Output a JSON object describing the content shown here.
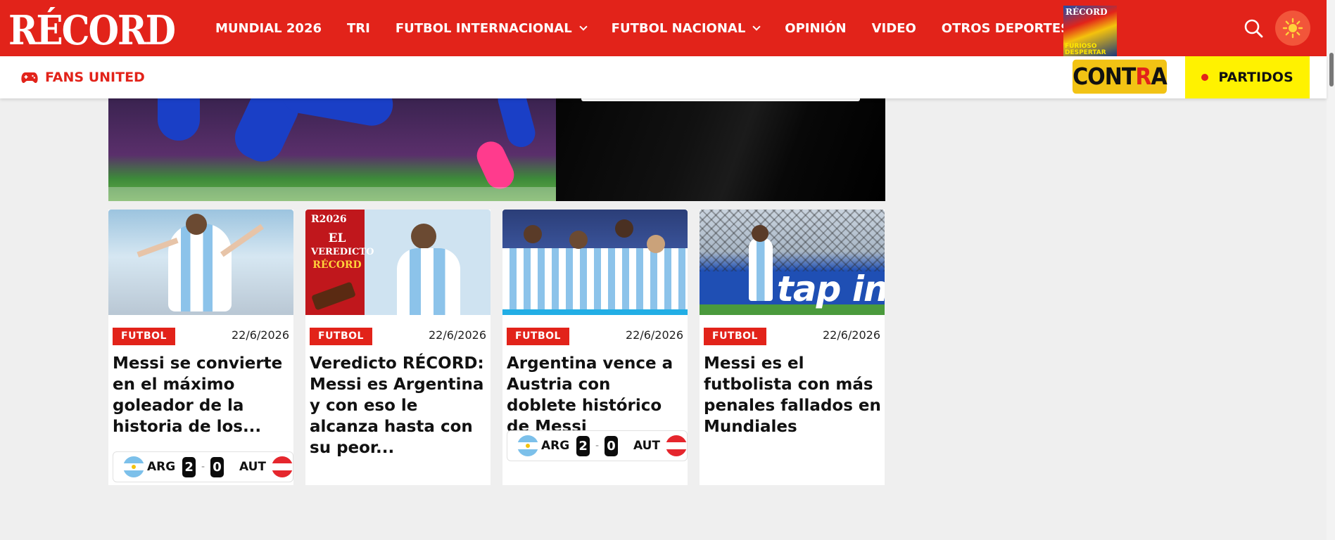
{
  "header": {
    "logo_text": "RÉCORD",
    "nav": [
      {
        "label": "MUNDIAL 2026",
        "has_dropdown": false
      },
      {
        "label": "TRI",
        "has_dropdown": false
      },
      {
        "label": "FUTBOL INTERNACIONAL",
        "has_dropdown": true
      },
      {
        "label": "FUTBOL NACIONAL",
        "has_dropdown": true
      },
      {
        "label": "OPINIÓN",
        "has_dropdown": false
      },
      {
        "label": "VIDEO",
        "has_dropdown": false
      },
      {
        "label": "OTROS DEPORTES",
        "has_dropdown": true
      }
    ],
    "cover": {
      "title": "RÉCORD",
      "headline": "FURIOSO DESPERTAR"
    },
    "icons": {
      "search": "search-icon",
      "theme": "sun-icon"
    },
    "colors": {
      "brand": "#e2231a",
      "theme_button": "#f2553a"
    }
  },
  "subbar": {
    "fans_label": "FANS UNITED",
    "contra_pre": "CONT",
    "contra_r": "R",
    "contra_post": "A",
    "partidos_label": "PARTIDOS",
    "partidos_color": "#fff200"
  },
  "cards": [
    {
      "tag": "FUTBOL",
      "date": "22/6/2026",
      "headline": "Messi se convierte en el máximo goleador de la historia de los...",
      "score": {
        "home": "ARG",
        "home_goals": "2",
        "away_goals": "0",
        "away": "AUT"
      }
    },
    {
      "tag": "FUTBOL",
      "date": "22/6/2026",
      "headline": "Veredicto RÉCORD: Messi es Argentina y con eso le alcanza hasta con su peor...",
      "thumb_text": {
        "year": "R2026",
        "line1": "EL",
        "line2": "VEREDICTO",
        "line3": "RÉCORD"
      }
    },
    {
      "tag": "FUTBOL",
      "date": "22/6/2026",
      "headline": "Argentina vence a Austria con doblete histórico de Messi",
      "score": {
        "home": "ARG",
        "home_goals": "2",
        "away_goals": "0",
        "away": "AUT"
      }
    },
    {
      "tag": "FUTBOL",
      "date": "22/6/2026",
      "headline": "Messi es el futbolista con más penales fallados en Mundiales",
      "thumb_text": {
        "ad": "tap in"
      }
    }
  ]
}
